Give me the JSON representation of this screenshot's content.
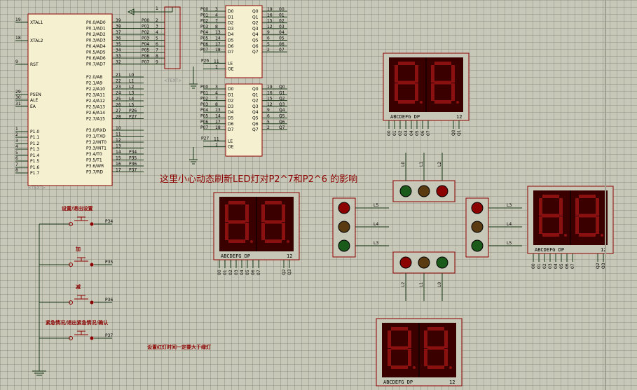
{
  "note_main": "这里小心动态刷新LED灯对P2^7和P2^6 的影响",
  "note_bottom": "设置红灯时间一定要大于绿灯",
  "btn_labels": [
    "设置/退出设置",
    "加",
    "减",
    "紧急情况/退出紧急情况/确认"
  ],
  "btn_nets": [
    "P34",
    "P35",
    "P36",
    "P37"
  ],
  "mcu_left_pins": [
    {
      "num": "19",
      "name": "XTAL1"
    },
    {
      "num": "18",
      "name": "XTAL2"
    },
    {
      "num": "9",
      "name": "RST"
    },
    {
      "num": "29",
      "name": "PSEN"
    },
    {
      "num": "30",
      "name": "ALE"
    },
    {
      "num": "31",
      "name": "EA"
    },
    {
      "num": "1",
      "name": "P1.0"
    },
    {
      "num": "2",
      "name": "P1.1"
    },
    {
      "num": "3",
      "name": "P1.2"
    },
    {
      "num": "4",
      "name": "P1.3"
    },
    {
      "num": "5",
      "name": "P1.4"
    },
    {
      "num": "6",
      "name": "P1.5"
    },
    {
      "num": "7",
      "name": "P1.6"
    },
    {
      "num": "8",
      "name": "P1.7"
    }
  ],
  "mcu_p0": [
    {
      "num": "39",
      "name": "P0.0/AD0",
      "net": "P00",
      "res": "2"
    },
    {
      "num": "38",
      "name": "P0.1/AD1",
      "net": "P01",
      "res": "3"
    },
    {
      "num": "37",
      "name": "P0.2/AD2",
      "net": "P02",
      "res": "4"
    },
    {
      "num": "36",
      "name": "P0.3/AD3",
      "net": "P03",
      "res": "5"
    },
    {
      "num": "35",
      "name": "P0.4/AD4",
      "net": "P04",
      "res": "6"
    },
    {
      "num": "34",
      "name": "P0.5/AD5",
      "net": "P05",
      "res": "7"
    },
    {
      "num": "33",
      "name": "P0.6/AD6",
      "net": "P06",
      "res": "8"
    },
    {
      "num": "32",
      "name": "P0.7/AD7",
      "net": "P07",
      "res": "9"
    }
  ],
  "mcu_p2": [
    {
      "num": "21",
      "name": "P2.0/A8",
      "net": "L0"
    },
    {
      "num": "22",
      "name": "P2.1/A9",
      "net": "L1"
    },
    {
      "num": "23",
      "name": "P2.2/A10",
      "net": "L2"
    },
    {
      "num": "24",
      "name": "P2.3/A11",
      "net": "L3"
    },
    {
      "num": "25",
      "name": "P2.4/A12",
      "net": "L4"
    },
    {
      "num": "26",
      "name": "P2.5/A13",
      "net": "L5"
    },
    {
      "num": "27",
      "name": "P2.6/A14",
      "net": "P26"
    },
    {
      "num": "28",
      "name": "P2.7/A15",
      "net": "P27"
    }
  ],
  "mcu_p3": [
    {
      "num": "10",
      "name": "P3.0/RXD",
      "net": ""
    },
    {
      "num": "11",
      "name": "P3.1/TXD",
      "net": ""
    },
    {
      "num": "12",
      "name": "P3.2/INT0",
      "net": ""
    },
    {
      "num": "13",
      "name": "P3.3/INT1",
      "net": ""
    },
    {
      "num": "14",
      "name": "P3.4/T0",
      "net": "P34"
    },
    {
      "num": "15",
      "name": "P3.5/T1",
      "net": "P35"
    },
    {
      "num": "16",
      "name": "P3.6/WR",
      "net": "P36"
    },
    {
      "num": "17",
      "name": "P3.7/RD",
      "net": "P37"
    }
  ],
  "latch1": {
    "in_nets": [
      "P00",
      "P01",
      "P02",
      "P03",
      "P04",
      "P05",
      "P06",
      "P07"
    ],
    "in_pins": [
      "3",
      "4",
      "7",
      "8",
      "13",
      "14",
      "17",
      "18"
    ],
    "out_pins": [
      "19",
      "16",
      "15",
      "12",
      "9",
      "6",
      "5",
      "2"
    ],
    "out_nets": [
      "00",
      "01",
      "02",
      "03",
      "04",
      "05",
      "06",
      "07"
    ],
    "le_net": "P26",
    "le_pin": "11",
    "oe_pin": "1"
  },
  "latch2": {
    "in_nets": [
      "P00",
      "P01",
      "P02",
      "P03",
      "P04",
      "P05",
      "P06",
      "P07"
    ],
    "in_pins": [
      "3",
      "4",
      "7",
      "8",
      "13",
      "14",
      "17",
      "18"
    ],
    "out_pins": [
      "19",
      "16",
      "15",
      "12",
      "9",
      "6",
      "5",
      "2"
    ],
    "out_nets": [
      "Q0",
      "Q1",
      "Q2",
      "Q3",
      "Q4",
      "Q5",
      "Q6",
      "Q7"
    ],
    "le_net": "P27",
    "le_pin": "11",
    "oe_pin": "1"
  },
  "latch_pin_names": {
    "d": [
      "D0",
      "D1",
      "D2",
      "D3",
      "D4",
      "D5",
      "D6",
      "D7"
    ],
    "q": [
      "Q0",
      "Q1",
      "Q2",
      "Q3",
      "Q4",
      "Q5",
      "Q6",
      "Q7"
    ],
    "le": "LE",
    "oe": "OE"
  },
  "respack_pin1": "1",
  "display_label": "ABCDEFG  DP",
  "display_pins": "12",
  "display_top_digits": "88",
  "display_nets_seg": [
    "00",
    "01",
    "02",
    "03",
    "04",
    "05",
    "06",
    "07"
  ],
  "display_nets_dig": [
    "Q0",
    "Q1"
  ],
  "display_nets_dig2": [
    "Q2",
    "Q3"
  ],
  "light_nets_left": [
    "L5",
    "L4",
    "L3"
  ],
  "light_nets_right": [
    "L3",
    "L4",
    "L5"
  ],
  "light_nets_top": [
    "L0",
    "L1",
    "L2"
  ],
  "light_nets_bottom": [
    "L2",
    "L1",
    "L0"
  ],
  "text_placeholder": "<TEXT>",
  "colors": {
    "red": "#8b0000",
    "green": "#1a5a1a",
    "amber": "#5a3a10",
    "seg_on": "#8b1010",
    "seg_bg": "#3a0000",
    "wire": "#1a3a1a",
    "body": "#f5f0d0"
  }
}
